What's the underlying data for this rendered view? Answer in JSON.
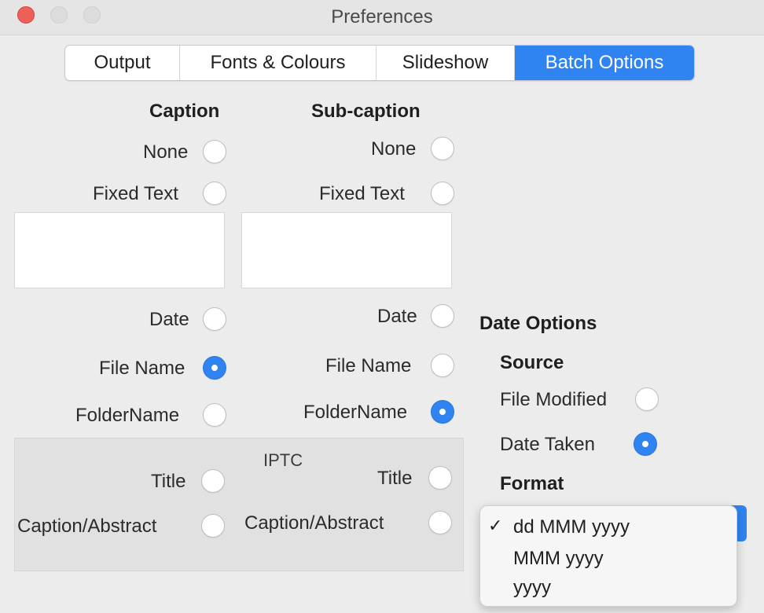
{
  "window": {
    "title": "Preferences"
  },
  "tabs": [
    {
      "label": "Output",
      "active": false
    },
    {
      "label": "Fonts & Colours",
      "active": false
    },
    {
      "label": "Slideshow",
      "active": false
    },
    {
      "label": "Batch Options",
      "active": true
    }
  ],
  "caption": {
    "heading": "Caption",
    "none": "None",
    "fixed_text": "Fixed Text",
    "date": "Date",
    "file_name": "File Name",
    "folder_name": "FolderName",
    "selected": "File Name"
  },
  "subcaption": {
    "heading": "Sub-caption",
    "none": "None",
    "fixed_text": "Fixed Text",
    "date": "Date",
    "file_name": "File Name",
    "folder_name": "FolderName",
    "selected": "FolderName"
  },
  "iptc": {
    "title": "IPTC",
    "caption_title": "Title",
    "caption_abstract": "Caption/Abstract",
    "subcaption_title": "Title",
    "subcaption_abstract": "Caption/Abstract"
  },
  "date_options": {
    "heading": "Date Options",
    "source_heading": "Source",
    "file_modified": "File Modified",
    "date_taken": "Date Taken",
    "source_selected": "Date Taken",
    "format_heading": "Format",
    "format_options": [
      "dd MMM yyyy",
      "MMM yyyy",
      "yyyy"
    ],
    "format_selected": "dd MMM yyyy",
    "check_glyph": "✓"
  },
  "colors": {
    "accent": "#2f84f2",
    "close": "#ee5f5a"
  }
}
